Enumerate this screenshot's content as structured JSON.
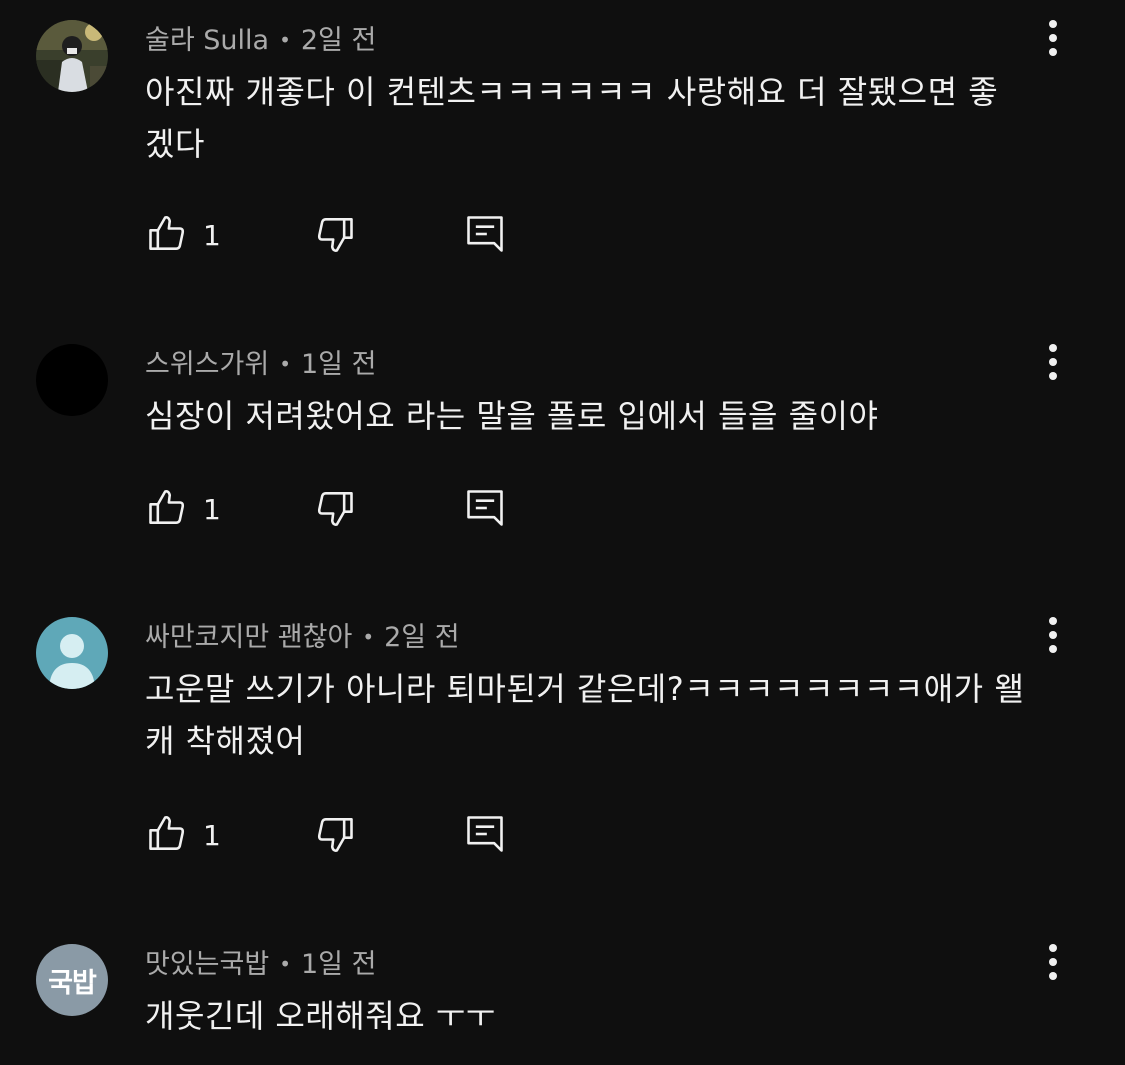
{
  "comments": [
    {
      "author": "술라 Sulla",
      "time": "2일 전",
      "text": "아진짜 개좋다 이 컨텐츠ㅋㅋㅋㅋㅋㅋ 사랑해요 더 잘됐으면 좋겠다",
      "likes": "1",
      "avatar": {
        "type": "photo"
      }
    },
    {
      "author": "스위스가위",
      "time": "1일 전",
      "text": "심장이 저려왔어요 라는 말을 폴로 입에서 들을 줄이야",
      "likes": "1",
      "avatar": {
        "type": "solid",
        "color": "#000000"
      }
    },
    {
      "author": "싸만코지만 괜찮아",
      "time": "2일 전",
      "text": "고운말 쓰기가 아니라 퇴마된거 같은데?ㅋㅋㅋㅋㅋㅋㅋㅋ애가 왤캐 착해졌어",
      "likes": "1",
      "avatar": {
        "type": "default-person",
        "color": "#5fa8b8"
      }
    },
    {
      "author": "맛있는국밥",
      "time": "1일 전",
      "text": "개웃긴데 오래해줘요 ㅜㅜ",
      "avatar": {
        "type": "initials",
        "initials": "국밥",
        "color": "#8a9aa6"
      }
    }
  ],
  "icons": {
    "like": "thumbs-up-icon",
    "dislike": "thumbs-down-icon",
    "reply": "reply-icon",
    "more": "more-vertical-icon"
  },
  "colors": {
    "background": "#0f0f0f",
    "text": "#f1f1f1",
    "meta": "#aaaaaa"
  }
}
